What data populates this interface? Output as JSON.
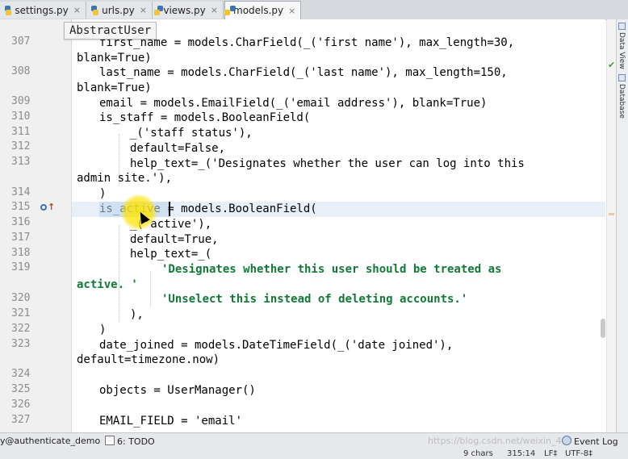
{
  "tabs": [
    {
      "label": "settings.py"
    },
    {
      "label": "urls.py"
    },
    {
      "label": "views.py"
    },
    {
      "label": "models.py",
      "active": true
    }
  ],
  "breadcrumb": "AbstractUser",
  "right_panel": {
    "data_view": "Data View",
    "database": "Database"
  },
  "gutter_lines": [
    "307",
    "308",
    "309",
    "310",
    "311",
    "312",
    "313",
    "314",
    "315",
    "316",
    "317",
    "318",
    "319",
    "320",
    "321",
    "322",
    "323",
    "324",
    "325",
    "326",
    "327"
  ],
  "code_lines": [
    "first_name = models.CharField(_('first name'), max_length=30,",
    "blank=True)",
    "last_name = models.CharField(_('last name'), max_length=150,",
    "blank=True)",
    "email = models.EmailField(_('email address'), blank=True)",
    "is_staff = models.BooleanField(",
    "_('staff status'),",
    "default=False,",
    "help_text=_('Designates whether the user can log into this",
    "admin site.'),",
    ")",
    "is_active = models.BooleanField(",
    "_('active'),",
    "default=True,",
    "help_text=_(",
    "'Designates whether this user should be treated as",
    "active. '",
    "'Unselect this instead of deleting accounts.'",
    "),",
    ")",
    "date_joined = models.DateTimeField(_('date joined'),",
    "default=timezone.now)",
    "objects = UserManager()",
    "EMAIL_FIELD = 'email'"
  ],
  "bottom_bar": {
    "left_text": "y@authenticate_demo",
    "todo": "6: TODO",
    "watermark": "https://blog.csdn.net/weixin_44",
    "event_log": "Event Log"
  },
  "status_bar": {
    "chars": "9 chars",
    "position": "315:14",
    "line_sep": "LF‡",
    "encoding": "UTF-8‡"
  },
  "colors": {
    "string": "#117a37",
    "keyword": "#000080",
    "selection": "#bcd3ee",
    "current_line": "#e8eff9"
  }
}
